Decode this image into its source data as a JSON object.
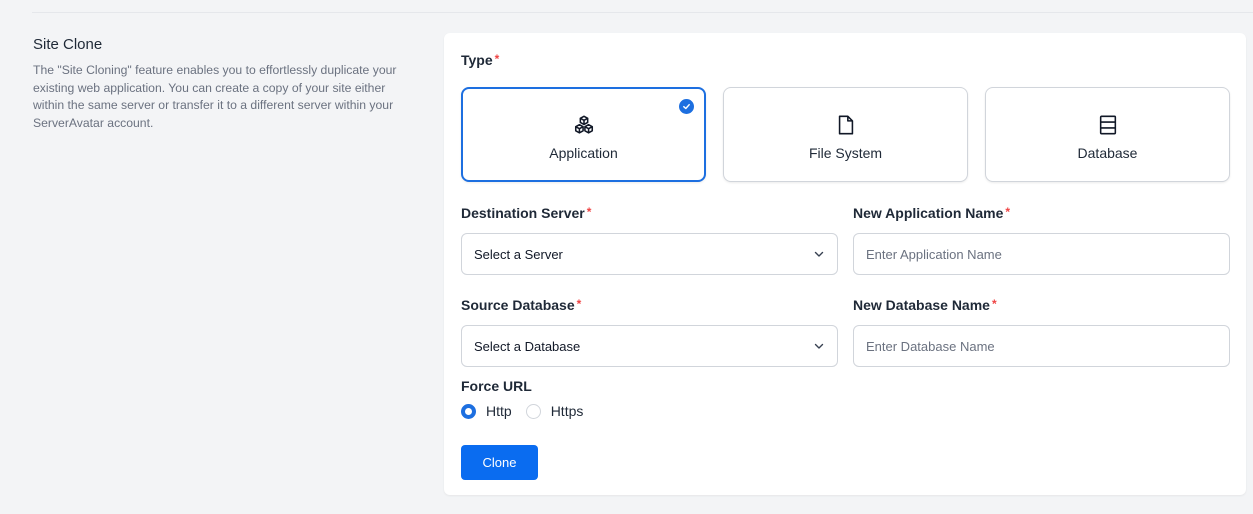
{
  "section": {
    "title": "Site Clone",
    "description": "The \"Site Cloning\" feature enables you to effortlessly duplicate your existing web application. You can create a copy of your site either within the same server or transfer it to a different server within your ServerAvatar account."
  },
  "form": {
    "type_label": "Type",
    "required_mark": "*",
    "types": [
      {
        "label": "Application",
        "icon": "cubes-icon",
        "selected": true
      },
      {
        "label": "File System",
        "icon": "file-icon",
        "selected": false
      },
      {
        "label": "Database",
        "icon": "database-icon",
        "selected": false
      }
    ],
    "destination_server": {
      "label": "Destination Server",
      "value": "Select a Server"
    },
    "new_application_name": {
      "label": "New Application Name",
      "value": "",
      "placeholder": "Enter Application Name"
    },
    "source_database": {
      "label": "Source Database",
      "value": "Select a Database"
    },
    "new_database_name": {
      "label": "New Database Name",
      "value": "",
      "placeholder": "Enter Database Name"
    },
    "force_url": {
      "label": "Force URL",
      "options": [
        {
          "label": "Http",
          "selected": true
        },
        {
          "label": "Https",
          "selected": false
        }
      ]
    },
    "submit_label": "Clone"
  },
  "colors": {
    "accent": "#1d6fe0",
    "button": "#0a6cf0",
    "required": "#ef4444",
    "muted_text": "#6b7280"
  }
}
